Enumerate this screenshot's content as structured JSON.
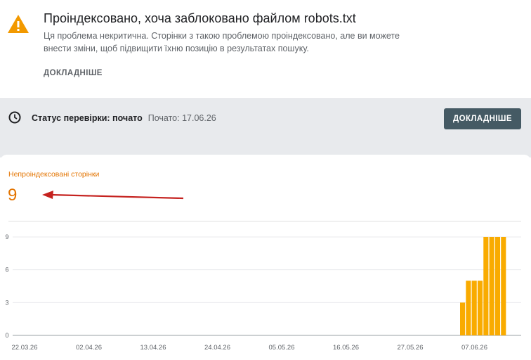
{
  "issue": {
    "title": "Проіндексовано, хоча заблоковано файлом robots.txt",
    "description": "Ця проблема некритична. Сторінки з такою проблемою проіндексовано, але ви можете внести зміни, щоб підвищити їхню позицію в результатах пошуку.",
    "link_label": "ДОКЛАДНІШЕ",
    "icon": "warning-icon",
    "icon_color": "#f29900"
  },
  "validation": {
    "label": "Статус перевірки: почато",
    "started": "Почато: 17.06.26",
    "button_label": "ДОКЛАДНІШЕ",
    "icon": "clock-icon"
  },
  "metric": {
    "label": "Непроіндексовані сторінки",
    "value": "9",
    "color": "#e37400"
  },
  "chart_data": {
    "type": "bar",
    "series": [
      {
        "values": [
          3,
          5,
          5,
          5,
          9,
          9,
          9,
          9
        ],
        "dates": [
          "06.06.26",
          "07.06.26",
          "08.06.26",
          "09.06.26",
          "10.06.26",
          "11.06.26",
          "12.06.26",
          "13.06.26"
        ],
        "color": "#f9ab00"
      }
    ],
    "y_ticks": [
      "0",
      "3",
      "6",
      "9"
    ],
    "x_ticks": [
      "22.03.26",
      "02.04.26",
      "13.04.26",
      "24.04.26",
      "05.05.26",
      "16.05.26",
      "27.05.26",
      "07.06.26"
    ],
    "ylim": [
      0,
      9
    ],
    "grid": true
  },
  "annotation": {
    "arrow_color": "#c5221f"
  }
}
